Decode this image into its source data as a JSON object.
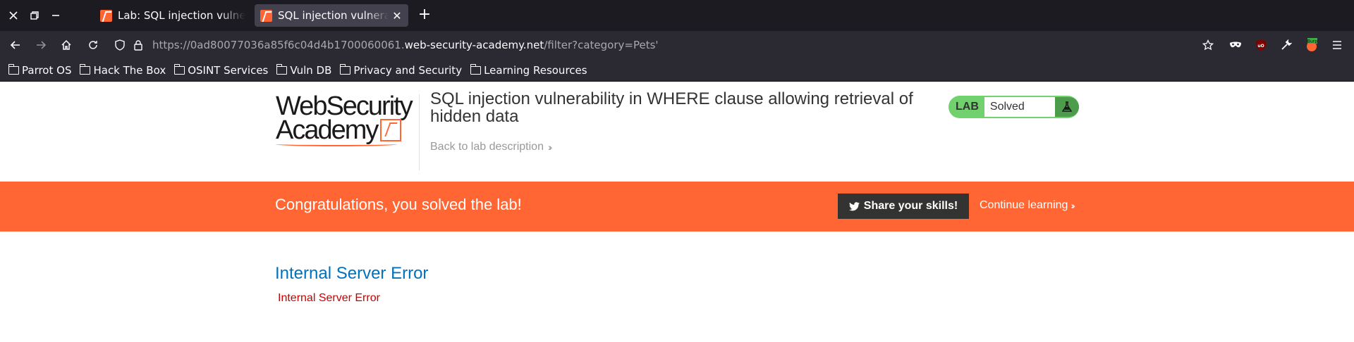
{
  "browser": {
    "tabs": [
      {
        "title": "Lab: SQL injection vulnerability in WHERE clause",
        "active": false
      },
      {
        "title": "SQL injection vulnerability in WHERE",
        "active": true
      }
    ],
    "url": {
      "prefix": "https://0ad80077036a85f6c04d4b1700060061.",
      "domain": "web-security-academy.net",
      "path": "/filter?category=Pets'"
    },
    "bookmarks": [
      "Parrot OS",
      "Hack The Box",
      "OSINT Services",
      "Vuln DB",
      "Privacy and Security",
      "Learning Resources"
    ],
    "extension_badge": "Burp"
  },
  "header": {
    "logo_line1": "WebSecurity",
    "logo_line2": "Academy",
    "lab_title": "SQL injection vulnerability in WHERE clause allowing retrieval of hidden data",
    "back_link": "Back to lab description",
    "lab_label": "LAB",
    "lab_status": "Solved"
  },
  "banner": {
    "message": "Congratulations, you solved the lab!",
    "share_label": "Share your skills!",
    "continue_label": "Continue learning"
  },
  "content": {
    "error_title": "Internal Server Error",
    "error_message": "Internal Server Error"
  },
  "colors": {
    "brand_orange": "#ff6633",
    "solved_green": "#70d16d",
    "error_red": "#cc0000",
    "link_blue": "#0071bc"
  }
}
